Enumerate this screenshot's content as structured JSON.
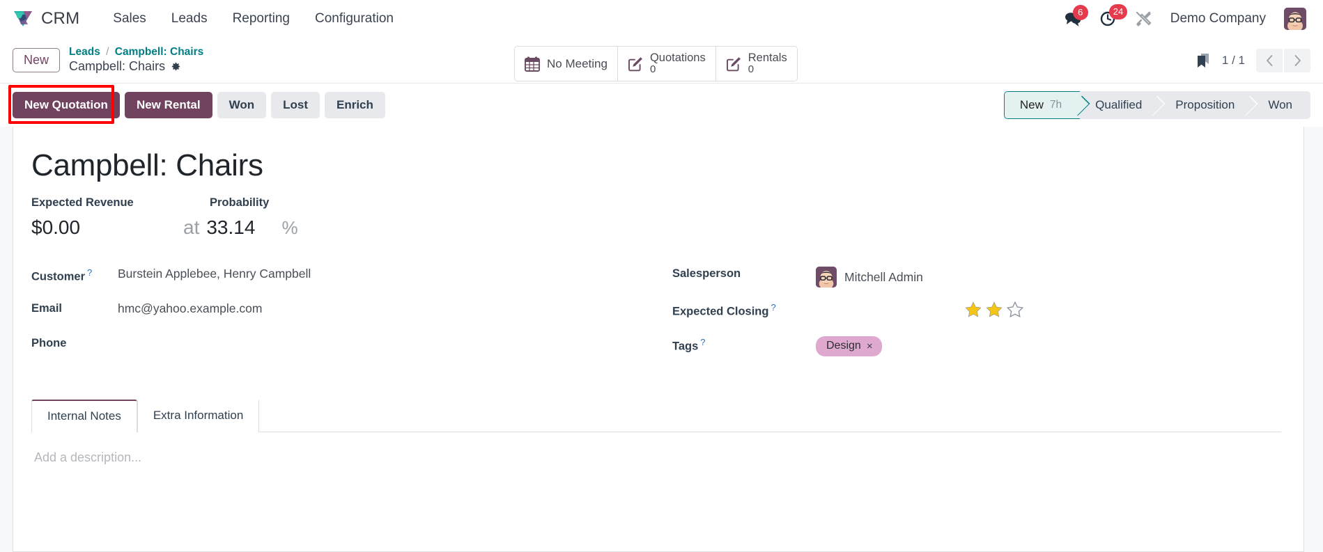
{
  "navbar": {
    "brand": "CRM",
    "menu": [
      {
        "label": "Sales"
      },
      {
        "label": "Leads"
      },
      {
        "label": "Reporting"
      },
      {
        "label": "Configuration"
      }
    ],
    "messages_icon": "chat-bubble-icon",
    "messages_count": "6",
    "activities_icon": "clock-icon",
    "activities_count": "24",
    "debug_icon": "tools-icon",
    "company": "Demo Company",
    "user_avatar": "user-avatar"
  },
  "control_panel": {
    "new_button": "New",
    "breadcrumb_parent": "Leads",
    "breadcrumb_separator": "/",
    "breadcrumb_current": "Campbell: Chairs",
    "record_title": "Campbell: Chairs",
    "settings_icon": "gear-icon",
    "stat_buttons": [
      {
        "icon": "calendar-icon",
        "label": "No Meeting",
        "value": ""
      },
      {
        "icon": "pencil-square-icon",
        "label": "Quotations",
        "value": "0"
      },
      {
        "icon": "pencil-square-icon",
        "label": "Rentals",
        "value": "0"
      }
    ],
    "bookmark_icon": "bookmark-icon",
    "pager": "1 / 1",
    "prev_icon": "chevron-left-icon",
    "next_icon": "chevron-right-icon"
  },
  "action_bar": {
    "buttons": [
      {
        "label": "New Quotation",
        "style": "primary",
        "highlighted": true
      },
      {
        "label": "New Rental",
        "style": "primary",
        "highlighted": false
      },
      {
        "label": "Won",
        "style": "secondary",
        "highlighted": false
      },
      {
        "label": "Lost",
        "style": "secondary",
        "highlighted": false
      },
      {
        "label": "Enrich",
        "style": "secondary",
        "highlighted": false
      }
    ],
    "highlight_color": "#FF0000",
    "primary_color": "#71435F",
    "secondary_color": "#E7E9ED"
  },
  "pipeline": {
    "stages": [
      {
        "label": "New",
        "duration": "7h",
        "active": true
      },
      {
        "label": "Qualified",
        "duration": "",
        "active": false
      },
      {
        "label": "Proposition",
        "duration": "",
        "active": false
      },
      {
        "label": "Won",
        "duration": "",
        "active": false
      }
    ],
    "active_color": "#017E84"
  },
  "form": {
    "title": "Campbell: Chairs",
    "expected_revenue_label": "Expected Revenue",
    "expected_revenue_value": "$0.00",
    "probability_label": "Probability",
    "probability_prefix": "at",
    "probability_value": "33.14",
    "probability_suffix": "%",
    "left_fields": [
      {
        "label": "Customer",
        "help": "?",
        "value": "Burstein Applebee, Henry Campbell"
      },
      {
        "label": "Email",
        "help": "",
        "value": "hmc@yahoo.example.com"
      },
      {
        "label": "Phone",
        "help": "",
        "value": ""
      }
    ],
    "salesperson_label": "Salesperson",
    "salesperson_value": "Mitchell Admin",
    "salesperson_avatar": "user-avatar",
    "expected_closing_label": "Expected Closing",
    "expected_closing_help": "?",
    "expected_closing_value": "",
    "priority_stars_filled": 2,
    "priority_stars_total": 3,
    "star_color": "#F5C518",
    "tags_label": "Tags",
    "tags_help": "?",
    "tags": [
      {
        "label": "Design",
        "remove": "×",
        "color": "#DFA8CF"
      }
    ]
  },
  "notebook": {
    "tabs": [
      {
        "label": "Internal Notes",
        "active": true
      },
      {
        "label": "Extra Information",
        "active": false
      }
    ],
    "description_placeholder": "Add a description..."
  }
}
